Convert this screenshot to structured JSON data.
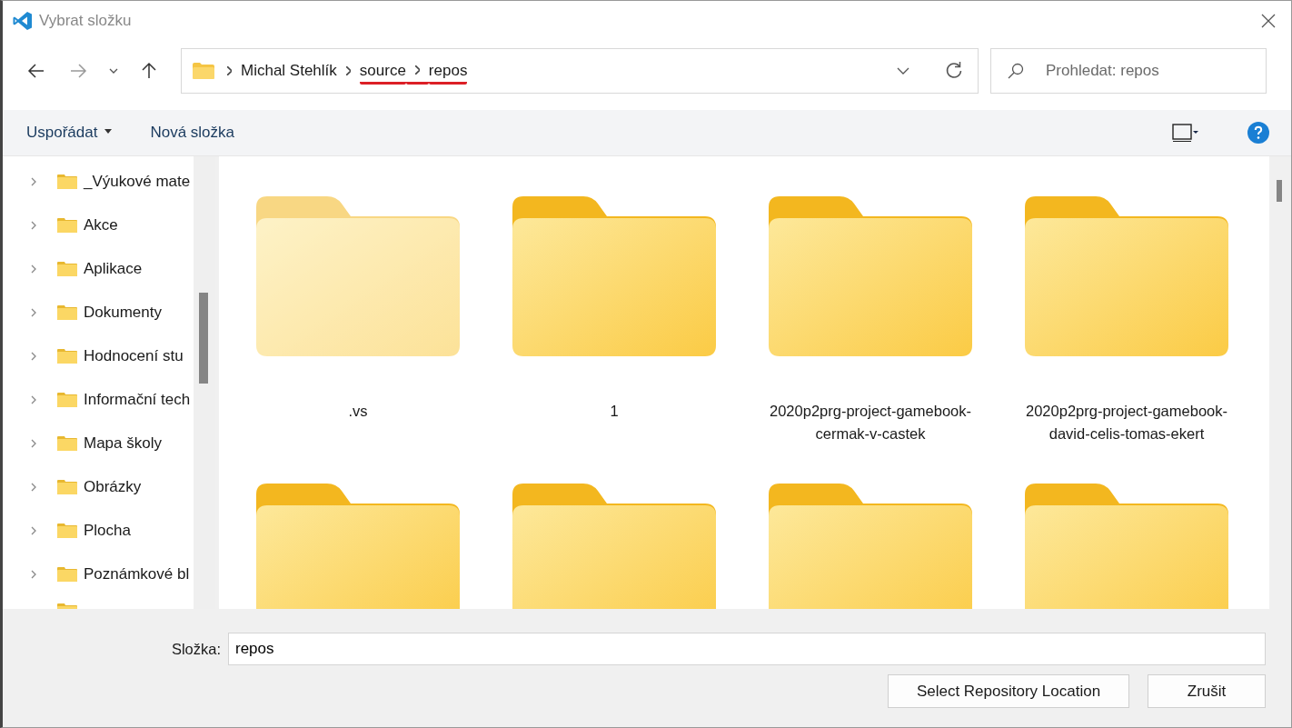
{
  "window": {
    "title": "Vybrat složku"
  },
  "breadcrumbs": [
    {
      "label": "Michal Stehlík",
      "underlined": false
    },
    {
      "label": "source",
      "underlined": true
    },
    {
      "label": "repos",
      "underlined": true
    }
  ],
  "search": {
    "placeholder": "Prohledat: repos"
  },
  "toolbar": {
    "organize": "Uspořádat",
    "new_folder": "Nová složka"
  },
  "sidebar": {
    "items": [
      {
        "label": "_Výukové mate"
      },
      {
        "label": "Akce"
      },
      {
        "label": "Aplikace"
      },
      {
        "label": "Dokumenty"
      },
      {
        "label": "Hodnocení stu"
      },
      {
        "label": "Informační tech"
      },
      {
        "label": "Mapa školy"
      },
      {
        "label": "Obrázky"
      },
      {
        "label": "Plocha"
      },
      {
        "label": "Poznámkové bl"
      }
    ]
  },
  "folders": [
    {
      "name": ".vs",
      "hidden": true
    },
    {
      "name": "1",
      "hidden": false
    },
    {
      "name": "2020p2prg-project-gamebook-cermak-v-castek",
      "hidden": false
    },
    {
      "name": "2020p2prg-project-gamebook-david-celis-tomas-ekert",
      "hidden": false
    },
    {
      "hidden": false
    },
    {
      "hidden": false
    },
    {
      "hidden": false
    },
    {
      "hidden": false
    }
  ],
  "footer": {
    "folder_label": "Složka:",
    "folder_value": "repos",
    "buttons": [
      "Select Repository Location",
      "Zrušit"
    ]
  }
}
